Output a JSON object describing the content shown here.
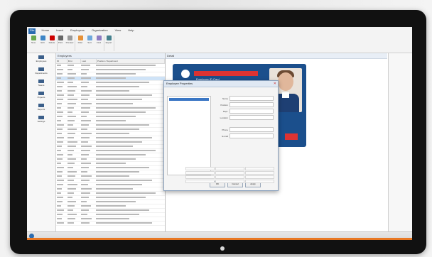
{
  "ribbon": {
    "tabs": [
      "File",
      "Home",
      "Insert",
      "Employees",
      "Organization",
      "View",
      "Help"
    ],
    "groups": [
      {
        "buttons": [
          "New",
          "Edit",
          "Delete"
        ]
      },
      {
        "buttons": [
          "Print",
          "Preview"
        ]
      },
      {
        "buttons": [
          "Filter",
          "Sort",
          "Find"
        ]
      },
      {
        "buttons": [
          "Export"
        ]
      }
    ]
  },
  "nav": {
    "items": [
      "Employees",
      "Departments",
      "Teams",
      "Projects",
      "Reports",
      "Settings"
    ]
  },
  "list": {
    "title": "Employees",
    "columns": [
      "ID",
      "First",
      "Last",
      "Position / Department"
    ],
    "rows": 38
  },
  "detail": {
    "title": "Detail",
    "card_banner": "Employee ID Card"
  },
  "dialog": {
    "title": "Employee Properties",
    "fields": [
      {
        "label": "Name",
        "value": ""
      },
      {
        "label": "Position",
        "value": ""
      },
      {
        "label": "Dept.",
        "value": ""
      },
      {
        "label": "Location",
        "value": ""
      },
      {
        "label": "Phone",
        "value": ""
      },
      {
        "label": "E-mail",
        "value": ""
      }
    ],
    "buttons": [
      "OK",
      "Cancel",
      "Apply"
    ]
  },
  "colors": {
    "accent": "#2b6cb0",
    "card_bg": "#1b4f8c",
    "banner_red": "#dd3333",
    "taskbar_orange": "#e87722"
  }
}
